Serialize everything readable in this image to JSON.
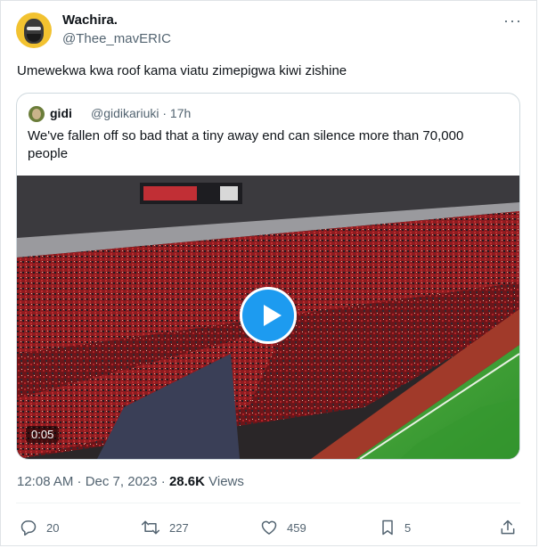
{
  "author": {
    "name": "Wachira.",
    "handle": "@Thee_mavERIC"
  },
  "tweet": {
    "text": "Umewekwa kwa roof kama viatu zimepigwa kiwi zishine",
    "timestamp": "12:08 AM · Dec 7, 2023 · ",
    "views_count": "28.6K",
    "views_label": " Views"
  },
  "quoted": {
    "name": "gidi",
    "handle": "@gidikariuki · 17h",
    "text": "We've fallen off so bad that a tiny away end can silence more than 70,000 people",
    "video_duration": "0:05"
  },
  "actions": {
    "replies": "20",
    "retweets": "227",
    "likes": "459",
    "bookmarks": "5"
  },
  "colors": {
    "accent": "#1d9bf0",
    "muted": "#536471",
    "pitch": "#3fa53a",
    "crowd_red": "#8e1c20"
  }
}
